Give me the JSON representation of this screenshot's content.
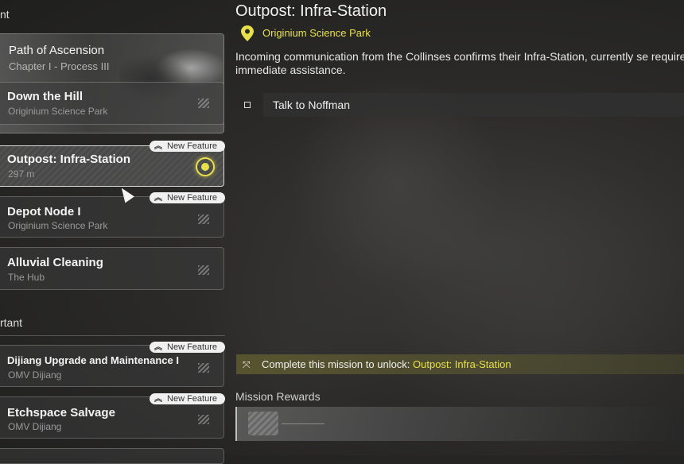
{
  "left_panel": {
    "section_top_header": "nt",
    "section_important_header": "rtant",
    "hero": {
      "title": "Path of Ascension",
      "subtitle": "Chapter I - Process III"
    },
    "cards_main": [
      {
        "title": "Down the Hill",
        "subtitle": "Originium Science Park",
        "badge": "",
        "selected": false
      },
      {
        "title": "Outpost: Infra-Station",
        "subtitle": "297 m",
        "badge": "New Feature",
        "selected": true
      },
      {
        "title": "Depot Node I",
        "subtitle": "Originium Science Park",
        "badge": "New Feature",
        "selected": false
      },
      {
        "title": "Alluvial Cleaning",
        "subtitle": "The Hub",
        "badge": "",
        "selected": false
      }
    ],
    "cards_important": [
      {
        "title": "Dijiang Upgrade and Maintenance I",
        "subtitle": "OMV Dijiang",
        "badge": "New Feature"
      },
      {
        "title": "Etchspace Salvage",
        "subtitle": "OMV Dijiang",
        "badge": "New Feature"
      }
    ]
  },
  "mission": {
    "title": "Outpost: Infra-Station",
    "location": "Originium Science Park",
    "description": "Incoming communication from the Collinses confirms their Infra-Station, currently se requires immediate assistance.",
    "objective": "Talk to Noffman",
    "unlock_prefix": "Complete this mission to unlock: ",
    "unlock_target": "Outpost: Infra-Station",
    "rewards_label": "Mission Rewards"
  },
  "colors": {
    "accent_yellow": "#e8e04a"
  },
  "icons": {
    "location": "map-pin-icon",
    "target": "tracking-target-icon",
    "badge": "double-chevron-up-icon",
    "unlock": "unlock-arrows-icon"
  }
}
